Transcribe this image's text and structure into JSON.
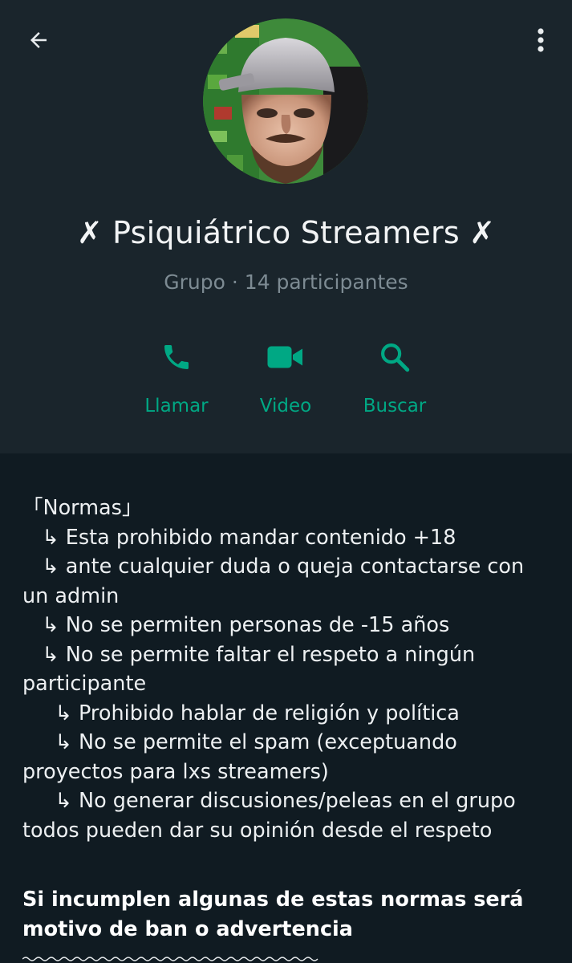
{
  "header": {
    "title": "✗ Psiquiátrico Streamers ✗",
    "subtitle": "Grupo · 14 participantes",
    "back_icon": "arrow-left-icon",
    "menu_icon": "more-vertical-icon",
    "avatar": "group-avatar-photo"
  },
  "actions": [
    {
      "label": "Llamar",
      "icon": "phone-icon"
    },
    {
      "label": "Video",
      "icon": "video-camera-icon"
    },
    {
      "label": "Buscar",
      "icon": "search-icon"
    }
  ],
  "colors": {
    "accent": "#00a884",
    "header_bg": "#1a252c",
    "page_bg": "#101b22",
    "muted_text": "#7d8b93"
  },
  "description": {
    "text": "「Normas」\n   ↳ Esta prohibido mandar contenido +18\n   ↳ ante cualquier duda o queja contactarse con\nun admin\n   ↳ No se permiten personas de -15 años\n   ↳ No se permite faltar el respeto a ningún\nparticipante\n     ↳ Prohibido hablar de religión y política\n     ↳ No se permite el spam (exceptuando\nproyectos para lxs streamers)\n     ↳ No generar discusiones/peleas en el grupo\ntodos pueden dar su opinión desde el respeto",
    "warning": "Si incumplen algunas de estas normas será\nmotivo de ban o advertencia"
  }
}
